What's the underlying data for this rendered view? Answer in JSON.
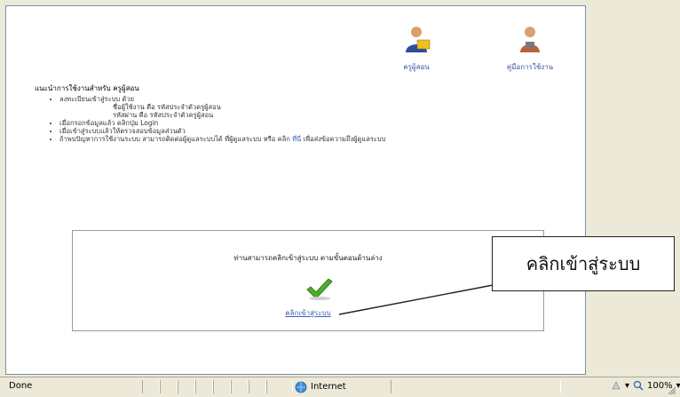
{
  "top_links": {
    "teacher_label": "ครูผู้สอน",
    "manual_label": "คู่มือการใช้งาน"
  },
  "heading": "แนะนำการใช้งานสำหรับ ครูผู้สอน",
  "instructions": [
    "ลงทะเบียนเข้าสู่ระบบ ด้วย",
    "ชื่อผู้ใช้งาน คือ รหัสประจำตัวครูผู้สอน",
    "รหัสผ่าน คือ รหัสประจำตัวครูผู้สอน",
    "เมื่อกรอกข้อมูลแล้ว คลิกปุ่ม Login",
    "เมื่อเข้าสู่ระบบแล้วให้ตรวจสอบข้อมูลส่วนตัว",
    "ถ้าพบปัญหาการใช้งานระบบ สามารถติดต่อผู้ดูแลระบบได้ ที่ผู้ดูแลระบบ หรือ คลิก",
    "เพื่อส่งข้อความถึงผู้ดูแลระบบ"
  ],
  "instruction_link": "ที่นี่",
  "login_box": {
    "message": "ท่านสามารถคลิกเข้าสู่ระบบ ตามขั้นตอนด้านล่าง",
    "link_label": "คลิกเข้าสู่ระบบ"
  },
  "callout": "คลิกเข้าสู่ระบบ",
  "statusbar": {
    "done": "Done",
    "zone": "Internet",
    "zoom": "100%"
  },
  "colors": {
    "link": "#3a62b8",
    "chrome": "#ece9d8",
    "check": "#4caf28"
  }
}
